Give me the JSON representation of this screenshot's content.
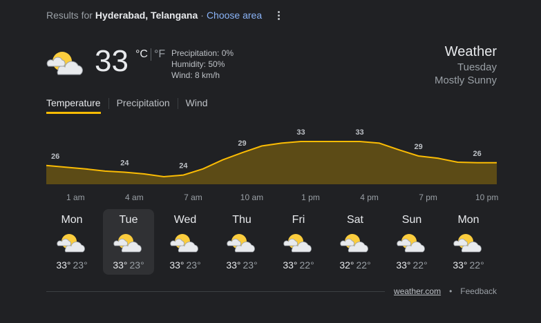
{
  "header": {
    "results_prefix": "Results for",
    "location": "Hyderabad, Telangana",
    "separator": "·",
    "choose_area": "Choose area"
  },
  "current": {
    "icon": "partly-sunny-icon",
    "temperature": "33",
    "unit_c": "°C",
    "unit_f": "°F",
    "precipitation": "Precipitation: 0%",
    "humidity": "Humidity: 50%",
    "wind": "Wind: 8 km/h"
  },
  "summary": {
    "title": "Weather",
    "day": "Tuesday",
    "condition": "Mostly Sunny"
  },
  "tabs": [
    "Temperature",
    "Precipitation",
    "Wind"
  ],
  "active_tab": "Temperature",
  "chart_data": {
    "type": "area",
    "color": "#fbbc04",
    "x": [
      "12 am",
      "1 am",
      "2 am",
      "3 am",
      "4 am",
      "5 am",
      "6 am",
      "7 am",
      "8 am",
      "9 am",
      "10 am",
      "11 am",
      "12 pm",
      "1 pm",
      "2 pm",
      "3 pm",
      "4 pm",
      "5 pm",
      "6 pm",
      "7 pm",
      "8 pm",
      "9 pm",
      "10 pm",
      "11 pm"
    ],
    "values": [
      26,
      25.7,
      25.4,
      25,
      24.8,
      24.5,
      24,
      24.3,
      25.4,
      27,
      28.3,
      29.5,
      30,
      30.3,
      30.3,
      30.3,
      30.3,
      30,
      28.8,
      27.7,
      27.3,
      26.6,
      26.5,
      26.5
    ],
    "point_labels": [
      {
        "x": "12 am",
        "label": "26"
      },
      {
        "x": "4 am",
        "label": "24"
      },
      {
        "x": "7 am",
        "label": "24"
      },
      {
        "x": "10 am",
        "label": "29"
      },
      {
        "x": "1 pm",
        "label": "33"
      },
      {
        "x": "4 pm",
        "label": "33"
      },
      {
        "x": "7 pm",
        "label": "29"
      },
      {
        "x": "10 pm",
        "label": "26"
      }
    ],
    "tick_labels": [
      "1 am",
      "4 am",
      "7 am",
      "10 am",
      "1 pm",
      "4 pm",
      "7 pm",
      "10 pm"
    ]
  },
  "forecast": [
    {
      "day": "Mon",
      "hi": "33°",
      "lo": "23°",
      "icon": "partly-sunny-icon"
    },
    {
      "day": "Tue",
      "hi": "33°",
      "lo": "23°",
      "icon": "partly-sunny-icon",
      "selected": true
    },
    {
      "day": "Wed",
      "hi": "33°",
      "lo": "23°",
      "icon": "partly-sunny-icon"
    },
    {
      "day": "Thu",
      "hi": "33°",
      "lo": "23°",
      "icon": "partly-sunny-icon"
    },
    {
      "day": "Fri",
      "hi": "33°",
      "lo": "22°",
      "icon": "partly-sunny-icon"
    },
    {
      "day": "Sat",
      "hi": "32°",
      "lo": "22°",
      "icon": "partly-sunny-icon"
    },
    {
      "day": "Sun",
      "hi": "33°",
      "lo": "22°",
      "icon": "partly-sunny-icon"
    },
    {
      "day": "Mon",
      "hi": "33°",
      "lo": "22°",
      "icon": "partly-sunny-icon"
    }
  ],
  "footer": {
    "source": "weather.com",
    "bullet": "•",
    "feedback": "Feedback"
  }
}
